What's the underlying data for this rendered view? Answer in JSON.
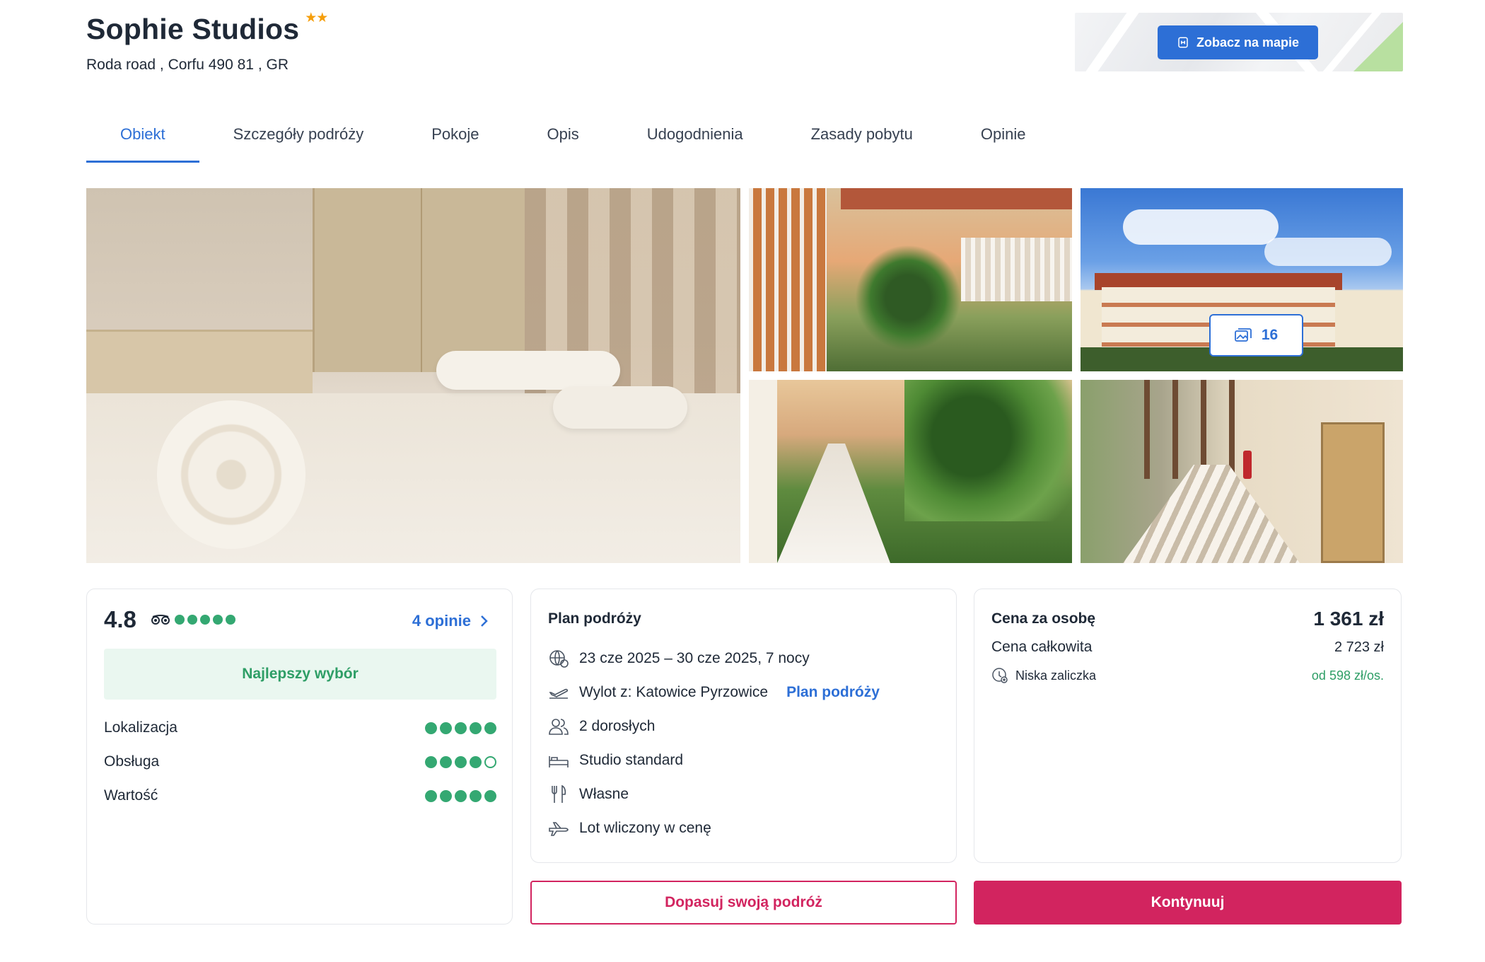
{
  "hotel": {
    "name": "Sophie Studios",
    "stars": "★★",
    "address": "Roda road , Corfu 490 81 , GR"
  },
  "map": {
    "button_label": "Zobacz na mapie",
    "button_color": "#2d6fd6"
  },
  "tabs": [
    {
      "label": "Obiekt",
      "active": true
    },
    {
      "label": "Szczegóły podróży",
      "active": false
    },
    {
      "label": "Pokoje",
      "active": false
    },
    {
      "label": "Opis",
      "active": false
    },
    {
      "label": "Udogodnienia",
      "active": false
    },
    {
      "label": "Zasady pobytu",
      "active": false
    },
    {
      "label": "Opinie",
      "active": false
    }
  ],
  "gallery": {
    "photo_count": "16"
  },
  "rating": {
    "score": "4.8",
    "provider_icon": "tripadvisor-icon",
    "bubbles": 5,
    "reviews_link": "4 opinie",
    "badge": "Najlepszy wybór",
    "badge_color": "#2e9e66",
    "subratings": [
      {
        "label": "Lokalizacja",
        "bubbles": 5
      },
      {
        "label": "Obsługa",
        "bubbles": 4
      },
      {
        "label": "Wartość",
        "bubbles": 5
      }
    ]
  },
  "plan": {
    "title": "Plan podróży",
    "dates": "23 cze 2025 – 30 cze 2025, 7 nocy",
    "departure": "Wylot z: Katowice Pyrzowice",
    "departure_link": "Plan podróży",
    "guests": "2 dorosłych",
    "room": "Studio standard",
    "board": "Własne",
    "flight": "Lot wliczony w cenę"
  },
  "price": {
    "per_person_label": "Cena za osobę",
    "per_person_value": "1 361 zł",
    "total_label": "Cena całkowita",
    "total_value": "2 723 zł",
    "deposit_label": "Niska zaliczka",
    "deposit_value": "od 598 zł/os."
  },
  "actions": {
    "customize_label": "Dopasuj swoją podróż",
    "continue_label": "Kontynuuj",
    "brand_color": "#d2245f"
  }
}
